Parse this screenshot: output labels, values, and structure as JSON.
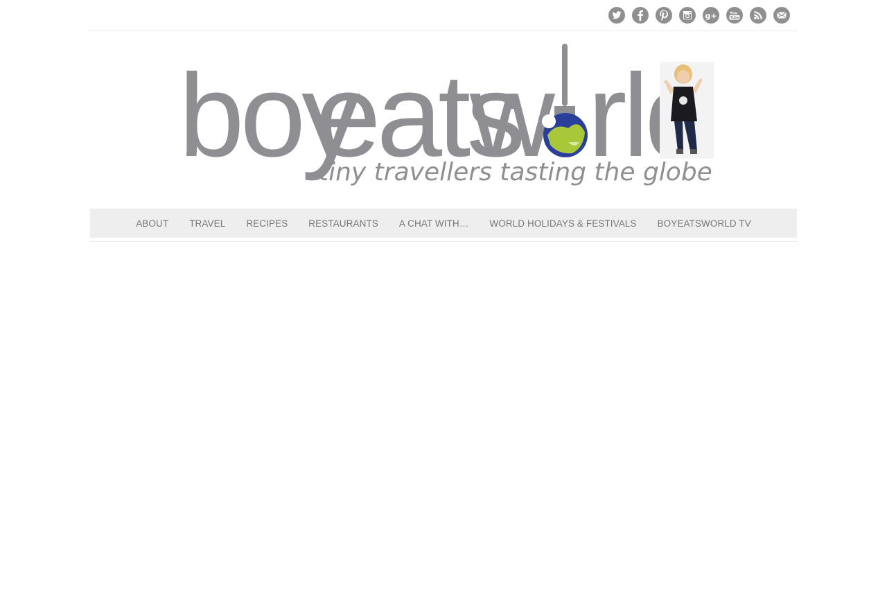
{
  "social": [
    {
      "name": "twitter-icon"
    },
    {
      "name": "facebook-icon"
    },
    {
      "name": "pinterest-icon"
    },
    {
      "name": "instagram-icon"
    },
    {
      "name": "google-plus-icon"
    },
    {
      "name": "youtube-icon"
    },
    {
      "name": "rss-icon"
    },
    {
      "name": "email-icon"
    }
  ],
  "logo": {
    "word1": "boy",
    "word2": "eats",
    "word3": "w",
    "word4": "rld",
    "tagline": "tiny travellers tasting the globe"
  },
  "nav": {
    "items": [
      "ABOUT",
      "TRAVEL",
      "RECIPES",
      "RESTAURANTS",
      "A CHAT WITH…",
      "WORLD HOLIDAYS & FESTIVALS",
      "BOYEATSWORLD TV"
    ]
  },
  "colors": {
    "icon": "#8f8f8f",
    "logo_gray": "#8e8e93",
    "globe_blue": "#2a3f9a",
    "globe_green": "#a8c83a",
    "nav_bg": "#eeeeee",
    "nav_text": "#777777"
  }
}
